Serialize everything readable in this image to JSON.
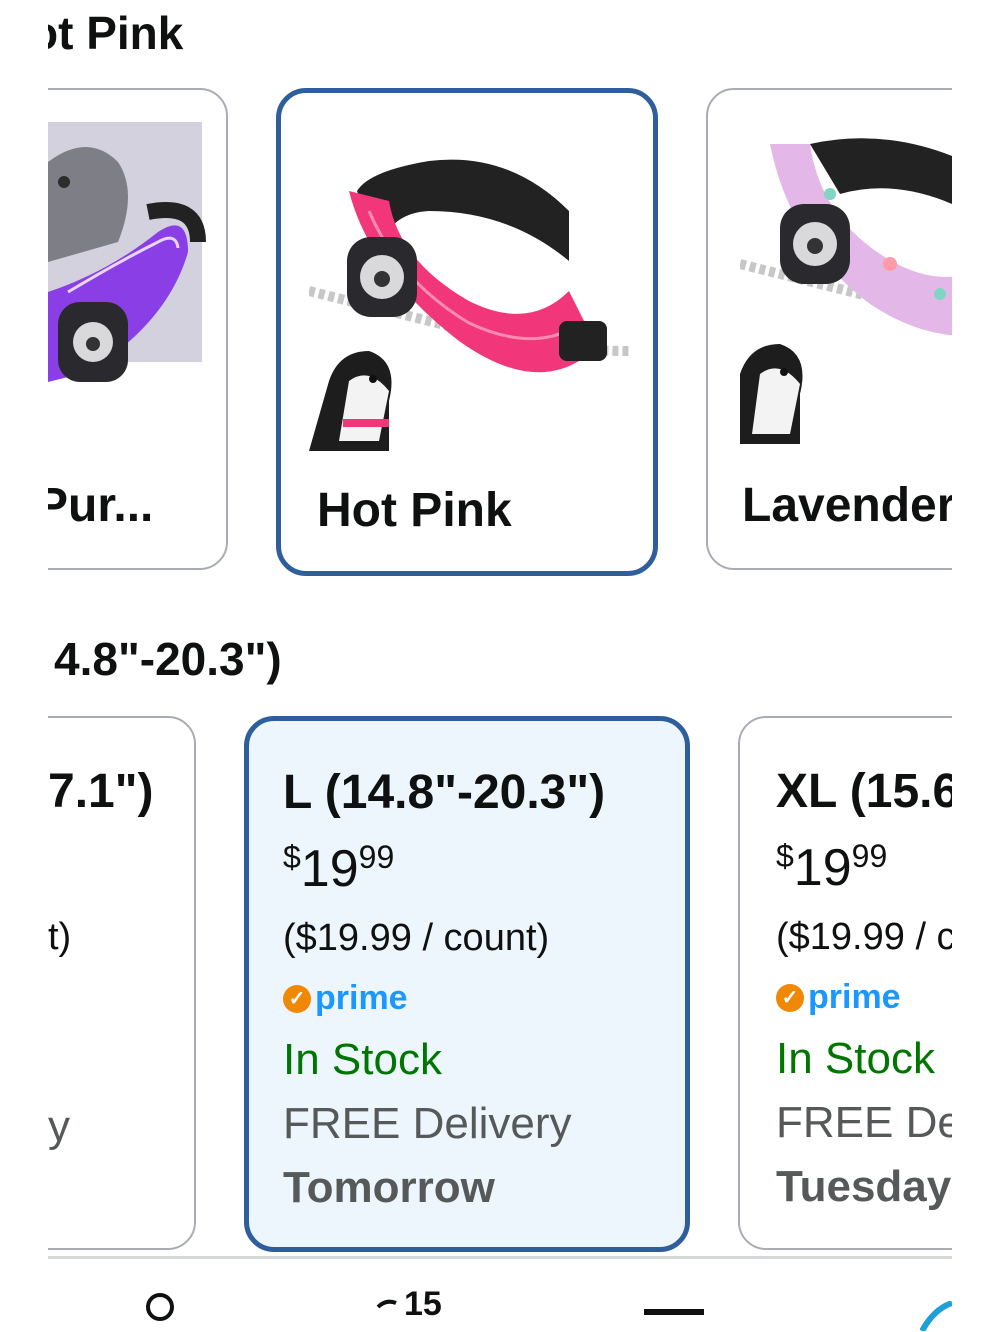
{
  "color_section": {
    "heading": "ot Pink"
  },
  "swatches": [
    {
      "label": "Pur...",
      "selected": false
    },
    {
      "label": "Hot Pink",
      "selected": true
    },
    {
      "label": "Lavender",
      "selected": false
    }
  ],
  "size_section": {
    "heading": "4.8\"-20.3\")"
  },
  "size_cards": [
    {
      "name": "7.1\")",
      "unit": "t)",
      "delivery": "y",
      "selected": false
    },
    {
      "name": "L (14.8\"-20.3\")",
      "price_symbol": "$",
      "price_whole": "19",
      "price_fraction": "99",
      "unit": "($19.99 / count)",
      "prime": "prime",
      "stock": "In Stock",
      "delivery": "FREE Delivery",
      "delivery_day": "Tomorrow",
      "selected": true
    },
    {
      "name": "XL (15.6",
      "price_symbol": "$",
      "price_whole": "19",
      "price_fraction": "99",
      "unit": "($19.99 / c",
      "prime": "prime",
      "stock": "In Stock",
      "delivery": "FREE Del",
      "delivery_day": "Tuesday",
      "selected": false
    }
  ],
  "bottom_nav": {
    "cart_count": "15"
  },
  "colors": {
    "selected_border": "#2e5f9c",
    "selected_bg": "#edf6fc",
    "stock_green": "#007600",
    "prime_blue": "#1a98ff",
    "prime_orange": "#f08804"
  }
}
